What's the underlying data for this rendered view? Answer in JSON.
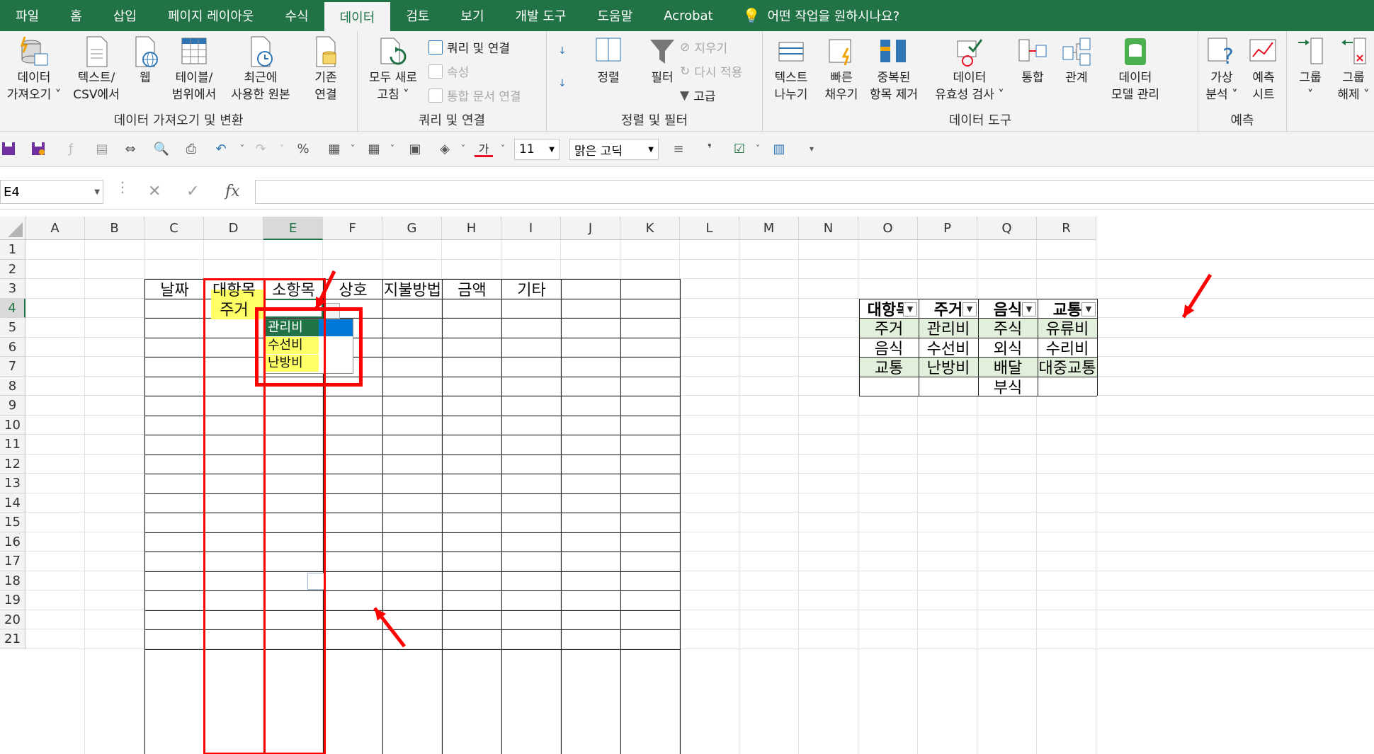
{
  "tabs": [
    "파일",
    "홈",
    "삽입",
    "페이지 레이아웃",
    "수식",
    "데이터",
    "검토",
    "보기",
    "개발 도구",
    "도움말",
    "Acrobat"
  ],
  "active_tab": "데이터",
  "tell_me": "어떤 작업을 원하시나요?",
  "ribbon": {
    "g1": {
      "label": "데이터 가져오기 및 변환",
      "btns": [
        "데이터\n가져오기 ˅",
        "텍스트/\nCSV에서",
        "웹",
        "테이블/\n범위에서",
        "최근에\n사용한 원본",
        "기존\n연결"
      ]
    },
    "g2": {
      "label": "쿼리 및 연결",
      "big": "모두 새로\n고침 ˅",
      "small": [
        "쿼리 및 연결",
        "속성",
        "통합 문서 연결"
      ]
    },
    "g3": {
      "label": "정렬 및 필터",
      "sort": "정렬",
      "filter": "필터",
      "small": [
        "지우기",
        "다시 적용",
        "고급"
      ]
    },
    "g4": {
      "label": "데이터 도구",
      "btns": [
        "텍스트\n나누기",
        "빠른\n채우기",
        "중복된\n항목 제거",
        "데이터\n유효성 검사 ˅",
        "통합",
        "관계",
        "데이터\n모델 관리"
      ]
    },
    "g5": {
      "label": "예측",
      "btns": [
        "가상\n분석 ˅",
        "예측\n시트"
      ]
    },
    "g6": {
      "btns": [
        "그룹\n˅",
        "그룹\n해제 ˅"
      ]
    }
  },
  "qat": {
    "font_size": "11",
    "font_name": "맑은 고딕"
  },
  "name_box": "E4",
  "fx": "fx",
  "columns": [
    "A",
    "B",
    "C",
    "D",
    "E",
    "F",
    "G",
    "H",
    "I",
    "J",
    "K",
    "L",
    "M",
    "N",
    "O",
    "P",
    "Q",
    "R"
  ],
  "rows": [
    "1",
    "2",
    "3",
    "4",
    "5",
    "6",
    "7",
    "8",
    "9",
    "10",
    "11",
    "12",
    "13",
    "14",
    "15",
    "16",
    "17",
    "18",
    "19",
    "20",
    "21"
  ],
  "main_table": {
    "headers": [
      "날짜",
      "대항목",
      "소항목",
      "상호",
      "지불방법",
      "금액",
      "기타"
    ],
    "d4": "주거"
  },
  "dropdown": [
    "관리비",
    "수선비",
    "난방비"
  ],
  "right_table": {
    "headers": [
      "대항목",
      "주거",
      "음식",
      "교통"
    ],
    "rows": [
      [
        "주거",
        "관리비",
        "주식",
        "유류비"
      ],
      [
        "음식",
        "수선비",
        "외식",
        "수리비"
      ],
      [
        "교통",
        "난방비",
        "배달",
        "대중교통"
      ],
      [
        "",
        "",
        "부식",
        ""
      ]
    ]
  },
  "colors": {
    "excel_green": "#217346",
    "highlight": "#ffff66",
    "table_band": "#e2efda",
    "selection_blue": "#0078d7",
    "annotation_red": "#ff0000"
  }
}
